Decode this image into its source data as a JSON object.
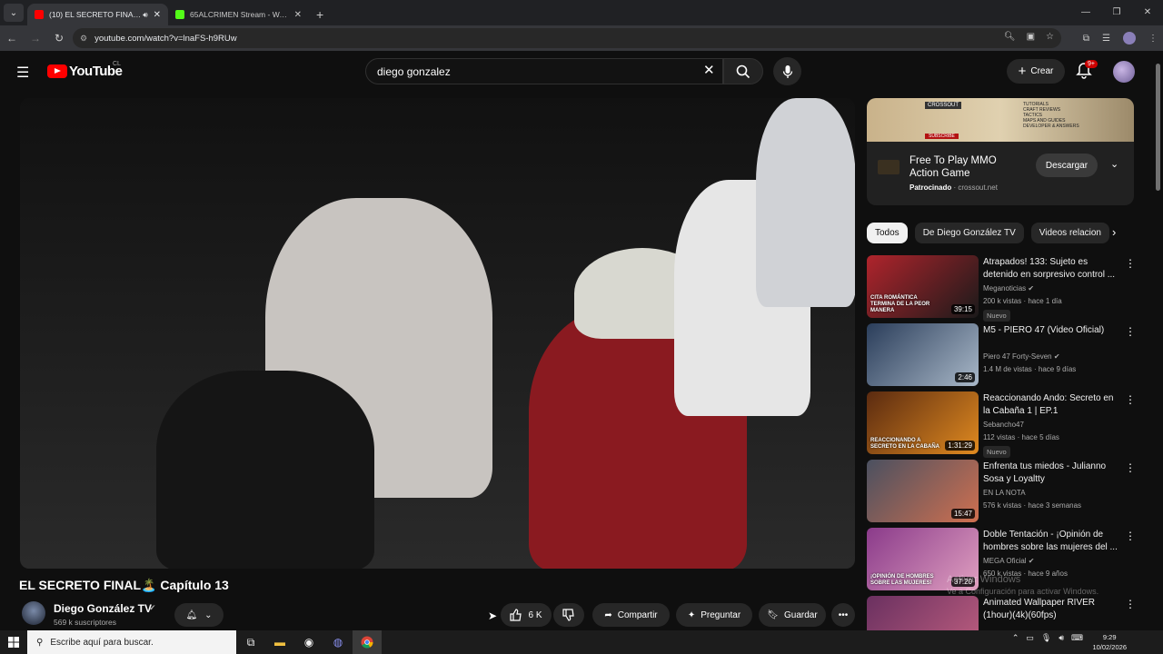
{
  "browser": {
    "tabs": [
      {
        "title": "(10) EL SECRETO FINAL🏝️ C",
        "active": true,
        "favicon_color": "#ff0000"
      },
      {
        "title": "65ALCRIMEN Stream - Watch L",
        "active": false,
        "favicon_color": "#53fc18"
      }
    ],
    "url": "youtube.com/watch?v=lnaFS-h9RUw"
  },
  "youtube": {
    "logo_text": "YouTube",
    "country_code": "CL",
    "search_value": "diego gonzalez",
    "create_label": "Crear",
    "notifications_badge": "9+"
  },
  "video": {
    "title": "EL SECRETO FINAL🏝️ Capítulo 13",
    "channel": "Diego González TV",
    "subscribers": "569 k suscriptores",
    "likes": "6 K",
    "share_label": "Compartir",
    "ask_label": "Preguntar",
    "save_label": "Guardar"
  },
  "ad": {
    "banner_brand": "CROSSOUT",
    "banner_subscribe": "SUBSCRIBE",
    "banner_text": "TUTORIALS\nCRAFT REVIEWS\nTACTICS\nMAPS AND GUIDES\nDEVELOPER & ANSWERS",
    "title": "Free To Play MMO Action Game",
    "sponsored": "Patrocinado",
    "domain": "crossout.net",
    "button": "Descargar"
  },
  "chips": [
    "Todos",
    "De Diego González TV",
    "Videos relacion"
  ],
  "recommendations": [
    {
      "title": "Atrapados! 133: Sujeto es detenido en sorpresivo control ...",
      "channel": "Meganoticias",
      "verified": true,
      "meta": "200 k vistas · hace 1 día",
      "duration": "39:15",
      "badge": "Nuevo",
      "thumb": [
        "#b0242c",
        "#1a1a1a"
      ],
      "thumb_text": "CITA ROMÁNTICA TERMINA DE LA PEOR MANERA"
    },
    {
      "title": "M5 - PIERO 47 (Video Oficial)",
      "channel": "Piero 47 Forty-Seven",
      "verified": true,
      "meta": "1.4 M de vistas · hace 9 días",
      "duration": "2:46",
      "badge": "",
      "thumb": [
        "#2a3d5a",
        "#a9b8c8"
      ],
      "thumb_text": ""
    },
    {
      "title": "Reaccionando Ando: Secreto en la Cabaña 1 | EP.1",
      "channel": "Sebancho47",
      "verified": false,
      "meta": "112 vistas · hace 5 días",
      "duration": "1:31:29",
      "badge": "Nuevo",
      "thumb": [
        "#5a2a10",
        "#e08a20"
      ],
      "thumb_text": "REACCIONANDO A SECRETO EN LA CABAÑA"
    },
    {
      "title": "Enfrenta tus miedos - Julianno Sosa y Loyaltty",
      "channel": "EN LA NOTA",
      "verified": false,
      "meta": "576 k vistas · hace 3 semanas",
      "duration": "15:47",
      "badge": "",
      "thumb": [
        "#4a5060",
        "#d07050"
      ],
      "thumb_text": ""
    },
    {
      "title": "Doble Tentación - ¡Opinión de hombres sobre las mujeres del ...",
      "channel": "MEGA Oficial",
      "verified": true,
      "meta": "650 k vistas · hace 9 años",
      "duration": "37:20",
      "badge": "",
      "thumb": [
        "#8a3a8a",
        "#e0a0c0"
      ],
      "thumb_text": "¡OPINIÓN DE HOMBRES SOBRE LAS MUJERES!"
    },
    {
      "title": "Animated Wallpaper RIVER (1hour)(4k)(60fps)",
      "channel": "",
      "verified": false,
      "meta": "",
      "duration": "",
      "badge": "",
      "thumb": [
        "#6a3060",
        "#c06080"
      ],
      "thumb_text": ""
    }
  ],
  "watermark": {
    "line1": "Activar Windows",
    "line2": "Ve a Configuración para activar Windows."
  },
  "taskbar": {
    "search_placeholder": "Escribe aquí para buscar.",
    "time": "9:29",
    "date": "10/02/2026"
  }
}
